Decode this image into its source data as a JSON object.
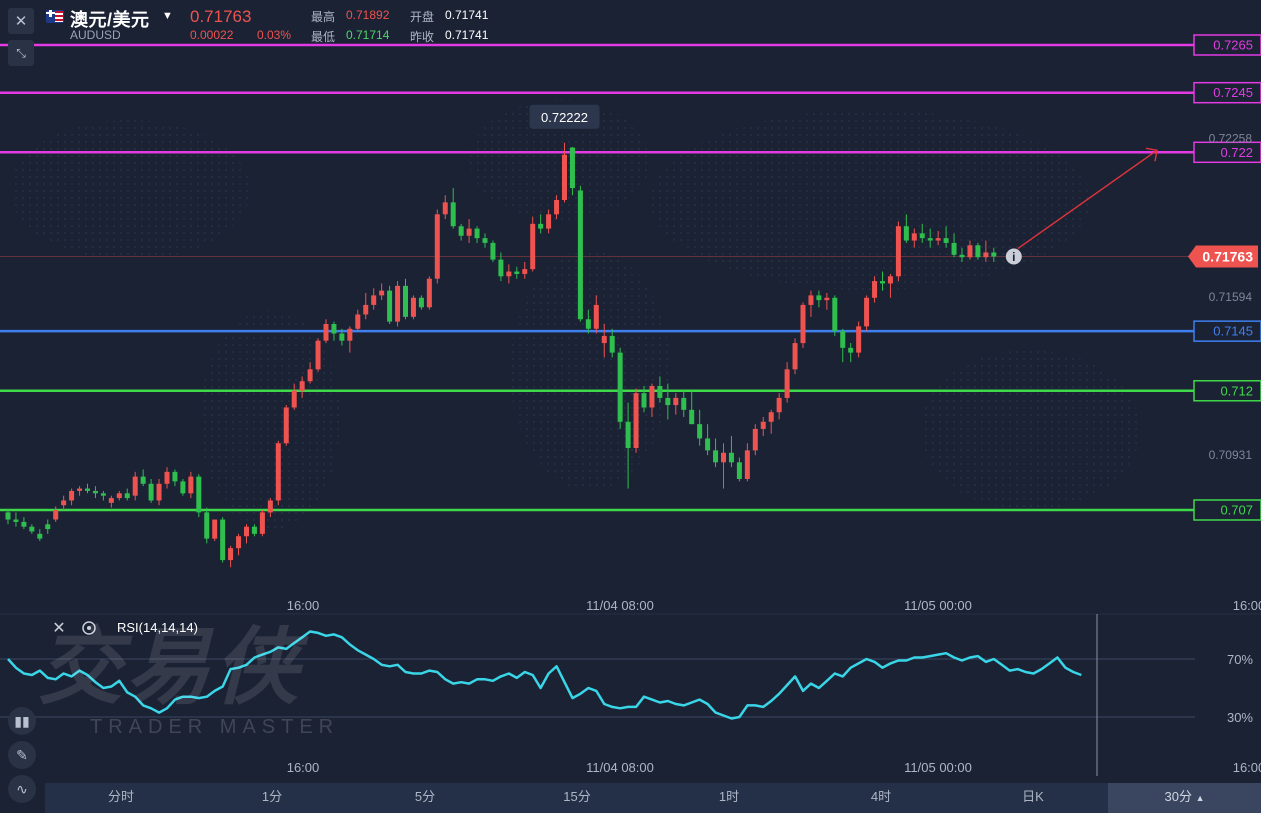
{
  "header": {
    "title": "澳元/美元",
    "code": "AUDUSD",
    "price": "0.71763",
    "change": "0.00022",
    "change_pct": "0.03%",
    "high_label": "最高",
    "high": "0.71892",
    "open_label": "开盘",
    "open": "0.71741",
    "low_label": "最低",
    "low": "0.71714",
    "prev_close_label": "昨收",
    "prev_close": "0.71741"
  },
  "watermark": {
    "cn": "交易侠",
    "en": "TRADER MASTER"
  },
  "colors": {
    "up": "#ef5350",
    "down": "#2fbf4f",
    "magenta": "#e33be3",
    "blue": "#3f7ff0",
    "green": "#3fd84a",
    "rsi": "#39d6e8"
  },
  "icons": [
    "close-icon",
    "collapse-icon",
    "info-icon",
    "settings-icon",
    "candles-icon",
    "pencil-icon",
    "indicator-icon",
    "caret-down-icon",
    "caret-up-icon"
  ],
  "price_axis": {
    "levels": [
      {
        "text": "0.7265",
        "value": 0.7265,
        "color": "#e33be3",
        "kind": "magenta"
      },
      {
        "text": "0.7245",
        "value": 0.7245,
        "color": "#e33be3",
        "kind": "magenta"
      },
      {
        "text": "0.722",
        "value": 0.722,
        "color": "#e33be3",
        "kind": "magenta"
      },
      {
        "text": "0.7145",
        "value": 0.7145,
        "color": "#3f7ff0",
        "kind": "blue"
      },
      {
        "text": "0.712",
        "value": 0.712,
        "color": "#3fd84a",
        "kind": "green"
      },
      {
        "text": "0.707",
        "value": 0.707,
        "color": "#3fd84a",
        "kind": "green"
      }
    ],
    "ticks": [
      {
        "text": "0.72258",
        "value": 0.72258
      },
      {
        "text": "0.71594",
        "value": 0.71594
      },
      {
        "text": "0.70931",
        "value": 0.70931
      }
    ],
    "current": {
      "text": "0.71763",
      "value": 0.71763
    },
    "peak_label": "0.72222"
  },
  "time_axis": [
    "16:00",
    "11/04 08:00",
    "11/05 00:00",
    "16:00"
  ],
  "rsi": {
    "title": "RSI(14,14,14)",
    "levels": [
      {
        "text": "70%",
        "value": 70
      },
      {
        "text": "30%",
        "value": 30
      }
    ],
    "values": [
      70,
      64,
      60,
      59,
      62,
      57,
      56,
      60,
      58,
      62,
      59,
      54,
      50,
      51,
      55,
      47,
      44,
      38,
      36,
      33,
      36,
      42,
      44,
      44,
      43,
      44,
      48,
      51,
      63,
      64,
      66,
      71,
      73,
      75,
      78,
      77,
      81,
      85,
      89,
      88,
      86,
      87,
      85,
      80,
      76,
      73,
      70,
      66,
      65,
      66,
      61,
      60,
      60,
      62,
      61,
      56,
      53,
      54,
      53,
      56,
      56,
      55,
      58,
      60,
      57,
      61,
      59,
      50,
      60,
      65,
      54,
      43,
      46,
      50,
      48,
      39,
      37,
      36,
      37,
      37,
      44,
      42,
      40,
      41,
      39,
      38,
      40,
      42,
      39,
      33,
      31,
      29,
      30,
      38,
      38,
      37,
      41,
      46,
      52,
      58,
      48,
      53,
      50,
      55,
      60,
      58,
      64,
      67,
      70,
      68,
      64,
      67,
      69,
      69,
      71,
      71,
      72,
      73,
      74,
      71,
      69,
      71,
      72,
      68,
      70,
      66,
      62,
      63,
      61,
      60,
      63,
      67,
      71,
      64,
      61,
      59
    ]
  },
  "timeframes": [
    "分时",
    "1分",
    "5分",
    "15分",
    "1时",
    "4时",
    "日K"
  ],
  "timeframe_selected": "30分",
  "chart_data": {
    "type": "candlestick",
    "title": "",
    "ylim": [
      0.7025,
      0.7275
    ],
    "candles": [
      [
        0.7069,
        0.70705,
        0.7064,
        0.7066
      ],
      [
        0.7066,
        0.7069,
        0.7063,
        0.7065
      ],
      [
        0.7065,
        0.7067,
        0.7062,
        0.7063
      ],
      [
        0.7063,
        0.7064,
        0.706,
        0.7061
      ],
      [
        0.706,
        0.7062,
        0.7057,
        0.7058
      ],
      [
        0.7064,
        0.7066,
        0.706,
        0.7062
      ],
      [
        0.7066,
        0.70715,
        0.7065,
        0.707
      ],
      [
        0.7072,
        0.7076,
        0.707,
        0.7074
      ],
      [
        0.7074,
        0.7079,
        0.7072,
        0.7078
      ],
      [
        0.7078,
        0.708,
        0.7076,
        0.7079
      ],
      [
        0.7079,
        0.7081,
        0.7077,
        0.7078
      ],
      [
        0.7078,
        0.708,
        0.7075,
        0.7077
      ],
      [
        0.7077,
        0.7078,
        0.7074,
        0.7076
      ],
      [
        0.7073,
        0.7076,
        0.7071,
        0.7075
      ],
      [
        0.7075,
        0.7078,
        0.7074,
        0.7077
      ],
      [
        0.7077,
        0.7079,
        0.7074,
        0.7075
      ],
      [
        0.7076,
        0.7086,
        0.7074,
        0.7084
      ],
      [
        0.7084,
        0.7087,
        0.708,
        0.7081
      ],
      [
        0.7081,
        0.7083,
        0.7073,
        0.7074
      ],
      [
        0.7074,
        0.7083,
        0.7072,
        0.7081
      ],
      [
        0.7081,
        0.7088,
        0.7079,
        0.7086
      ],
      [
        0.7086,
        0.7087,
        0.708,
        0.7082
      ],
      [
        0.7082,
        0.7083,
        0.7076,
        0.7077
      ],
      [
        0.7077,
        0.7086,
        0.7075,
        0.7084
      ],
      [
        0.7084,
        0.7085,
        0.7067,
        0.7069
      ],
      [
        0.7069,
        0.7071,
        0.7056,
        0.7058
      ],
      [
        0.7058,
        0.7066,
        0.7057,
        0.7066
      ],
      [
        0.7066,
        0.7067,
        0.7048,
        0.7049
      ],
      [
        0.7049,
        0.7055,
        0.7046,
        0.7054
      ],
      [
        0.7054,
        0.706,
        0.7051,
        0.7059
      ],
      [
        0.7059,
        0.7064,
        0.7056,
        0.7063
      ],
      [
        0.7063,
        0.7064,
        0.7059,
        0.706
      ],
      [
        0.706,
        0.707,
        0.7059,
        0.7069
      ],
      [
        0.7069,
        0.7075,
        0.7067,
        0.7074
      ],
      [
        0.7074,
        0.7099,
        0.7072,
        0.7098
      ],
      [
        0.7098,
        0.7114,
        0.7097,
        0.7113
      ],
      [
        0.7113,
        0.7123,
        0.7112,
        0.712
      ],
      [
        0.712,
        0.7126,
        0.7117,
        0.7124
      ],
      [
        0.7124,
        0.7132,
        0.7123,
        0.7129
      ],
      [
        0.7129,
        0.7142,
        0.7128,
        0.7141
      ],
      [
        0.7141,
        0.715,
        0.714,
        0.7148
      ],
      [
        0.7148,
        0.7149,
        0.7141,
        0.7144
      ],
      [
        0.7144,
        0.7146,
        0.7139,
        0.7141
      ],
      [
        0.7141,
        0.7147,
        0.7136,
        0.7146
      ],
      [
        0.7146,
        0.7154,
        0.7145,
        0.7152
      ],
      [
        0.7152,
        0.7161,
        0.715,
        0.7156
      ],
      [
        0.7156,
        0.7163,
        0.7154,
        0.716
      ],
      [
        0.716,
        0.7165,
        0.7158,
        0.7162
      ],
      [
        0.7162,
        0.7164,
        0.7148,
        0.7149
      ],
      [
        0.7149,
        0.7166,
        0.7147,
        0.7164
      ],
      [
        0.7164,
        0.7167,
        0.715,
        0.7151
      ],
      [
        0.7151,
        0.716,
        0.715,
        0.7159
      ],
      [
        0.7159,
        0.716,
        0.7154,
        0.7155
      ],
      [
        0.7155,
        0.7168,
        0.7154,
        0.7167
      ],
      [
        0.7167,
        0.7196,
        0.7165,
        0.7194
      ],
      [
        0.7194,
        0.7202,
        0.7192,
        0.7199
      ],
      [
        0.7199,
        0.7205,
        0.7188,
        0.7189
      ],
      [
        0.7189,
        0.719,
        0.7183,
        0.7185
      ],
      [
        0.7185,
        0.7192,
        0.7182,
        0.7188
      ],
      [
        0.7188,
        0.7189,
        0.7182,
        0.7184
      ],
      [
        0.7184,
        0.7186,
        0.718,
        0.7182
      ],
      [
        0.7182,
        0.7183,
        0.7174,
        0.7175
      ],
      [
        0.7175,
        0.7178,
        0.7166,
        0.7168
      ],
      [
        0.7168,
        0.7173,
        0.7165,
        0.717
      ],
      [
        0.717,
        0.7172,
        0.7167,
        0.7169
      ],
      [
        0.7169,
        0.7174,
        0.7167,
        0.7171
      ],
      [
        0.7171,
        0.7193,
        0.717,
        0.719
      ],
      [
        0.719,
        0.7194,
        0.7186,
        0.7188
      ],
      [
        0.7188,
        0.7196,
        0.7186,
        0.7194
      ],
      [
        0.7194,
        0.7202,
        0.7192,
        0.72
      ],
      [
        0.72,
        0.7224,
        0.7199,
        0.7219
      ],
      [
        0.7222,
        0.72222,
        0.7202,
        0.7205
      ],
      [
        0.7204,
        0.7206,
        0.7149,
        0.715
      ],
      [
        0.715,
        0.7154,
        0.7144,
        0.7146
      ],
      [
        0.7146,
        0.716,
        0.7144,
        0.7156
      ],
      [
        0.714,
        0.7148,
        0.7134,
        0.7143
      ],
      [
        0.7143,
        0.7146,
        0.7134,
        0.7136
      ],
      [
        0.7136,
        0.7138,
        0.7104,
        0.7107
      ],
      [
        0.7107,
        0.7115,
        0.7079,
        0.7096
      ],
      [
        0.7096,
        0.7121,
        0.7094,
        0.7119
      ],
      [
        0.7119,
        0.7122,
        0.7111,
        0.7113
      ],
      [
        0.7113,
        0.7123,
        0.7109,
        0.7122
      ],
      [
        0.7122,
        0.7126,
        0.7115,
        0.7117
      ],
      [
        0.7117,
        0.7123,
        0.7108,
        0.7114
      ],
      [
        0.7114,
        0.7119,
        0.711,
        0.7117
      ],
      [
        0.7117,
        0.712,
        0.7109,
        0.7112
      ],
      [
        0.7112,
        0.712,
        0.7106,
        0.7106
      ],
      [
        0.7106,
        0.7112,
        0.7097,
        0.71
      ],
      [
        0.71,
        0.7106,
        0.7093,
        0.7095
      ],
      [
        0.7095,
        0.71,
        0.7088,
        0.709
      ],
      [
        0.709,
        0.7098,
        0.7079,
        0.7094
      ],
      [
        0.7094,
        0.7101,
        0.7088,
        0.709
      ],
      [
        0.709,
        0.7092,
        0.7082,
        0.7083
      ],
      [
        0.7083,
        0.7098,
        0.7082,
        0.7095
      ],
      [
        0.7095,
        0.7106,
        0.7093,
        0.7104
      ],
      [
        0.7104,
        0.7109,
        0.7101,
        0.7107
      ],
      [
        0.7107,
        0.7112,
        0.7102,
        0.7111
      ],
      [
        0.7111,
        0.7119,
        0.7108,
        0.7117
      ],
      [
        0.7117,
        0.7132,
        0.7115,
        0.7129
      ],
      [
        0.7129,
        0.7142,
        0.7127,
        0.714
      ],
      [
        0.714,
        0.7157,
        0.7138,
        0.7156
      ],
      [
        0.7156,
        0.7162,
        0.7151,
        0.716
      ],
      [
        0.716,
        0.7162,
        0.7155,
        0.7158
      ],
      [
        0.7158,
        0.7161,
        0.7154,
        0.7159
      ],
      [
        0.7159,
        0.716,
        0.7143,
        0.7145
      ],
      [
        0.7145,
        0.7146,
        0.7132,
        0.7138
      ],
      [
        0.7138,
        0.714,
        0.7132,
        0.7136
      ],
      [
        0.7136,
        0.7149,
        0.7134,
        0.7147
      ],
      [
        0.7147,
        0.716,
        0.7145,
        0.7159
      ],
      [
        0.7159,
        0.7168,
        0.7157,
        0.7166
      ],
      [
        0.7166,
        0.717,
        0.7162,
        0.7165
      ],
      [
        0.7165,
        0.7169,
        0.7159,
        0.7168
      ],
      [
        0.7168,
        0.7191,
        0.7166,
        0.7189
      ],
      [
        0.7189,
        0.7194,
        0.7182,
        0.7183
      ],
      [
        0.7183,
        0.7188,
        0.718,
        0.7186
      ],
      [
        0.7186,
        0.719,
        0.7182,
        0.7184
      ],
      [
        0.7184,
        0.7188,
        0.718,
        0.7183
      ],
      [
        0.7183,
        0.7187,
        0.7181,
        0.7184
      ],
      [
        0.7184,
        0.7189,
        0.718,
        0.7182
      ],
      [
        0.7182,
        0.7186,
        0.7176,
        0.7177
      ],
      [
        0.7177,
        0.718,
        0.7174,
        0.7176
      ],
      [
        0.7176,
        0.7183,
        0.7175,
        0.7181
      ],
      [
        0.7181,
        0.7182,
        0.7175,
        0.7176
      ],
      [
        0.7176,
        0.7183,
        0.7174,
        0.7178
      ],
      [
        0.7178,
        0.718,
        0.7174,
        0.71763
      ]
    ]
  }
}
